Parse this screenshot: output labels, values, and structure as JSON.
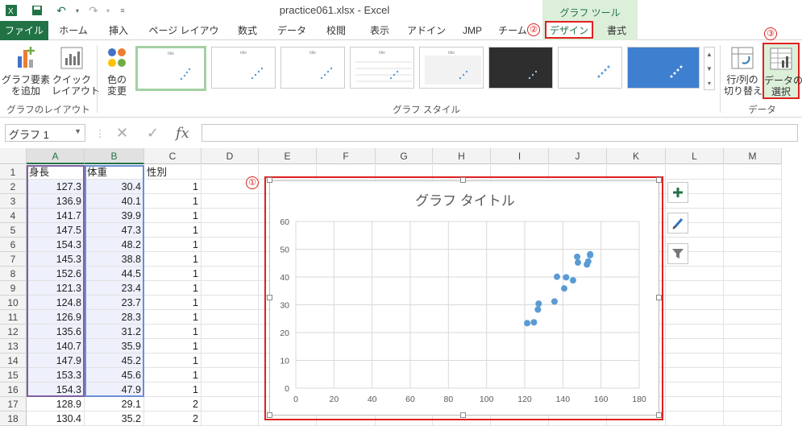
{
  "app": {
    "title": "practice061.xlsx - Excel",
    "context_tool": "グラフ ツール"
  },
  "tabs": [
    "ファイル",
    "ホーム",
    "挿入",
    "ページ レイアウト",
    "数式",
    "データ",
    "校閲",
    "表示",
    "アドイン",
    "JMP",
    "チーム",
    "デザイン",
    "書式"
  ],
  "ribbon": {
    "add_element": "グラフ要素\nを追加",
    "quick_layout": "クイック\nレイアウト",
    "change_colors": "色の\n変更",
    "layout_group": "グラフのレイアウト",
    "styles_group": "グラフ スタイル",
    "switch_rowcol": "行/列の\n切り替え",
    "select_data": "データの\n選択",
    "data_group": "データ"
  },
  "formula_bar": {
    "name_box": "グラフ 1",
    "formula": ""
  },
  "grid": {
    "columns": [
      "A",
      "B",
      "C",
      "D",
      "E",
      "F",
      "G",
      "H",
      "I",
      "J",
      "K",
      "L",
      "M"
    ],
    "rows": [
      [
        "身長",
        "体重",
        "性別"
      ],
      [
        "127.3",
        "30.4",
        "1"
      ],
      [
        "136.9",
        "40.1",
        "1"
      ],
      [
        "141.7",
        "39.9",
        "1"
      ],
      [
        "147.5",
        "47.3",
        "1"
      ],
      [
        "154.3",
        "48.2",
        "1"
      ],
      [
        "145.3",
        "38.8",
        "1"
      ],
      [
        "152.6",
        "44.5",
        "1"
      ],
      [
        "121.3",
        "23.4",
        "1"
      ],
      [
        "124.8",
        "23.7",
        "1"
      ],
      [
        "126.9",
        "28.3",
        "1"
      ],
      [
        "135.6",
        "31.2",
        "1"
      ],
      [
        "140.7",
        "35.9",
        "1"
      ],
      [
        "147.9",
        "45.2",
        "1"
      ],
      [
        "153.3",
        "45.6",
        "1"
      ],
      [
        "154.3",
        "47.9",
        "1"
      ],
      [
        "128.9",
        "29.1",
        "2"
      ],
      [
        "130.4",
        "35.2",
        "2"
      ]
    ]
  },
  "annotations": [
    "①",
    "②",
    "③"
  ],
  "chart_data": {
    "type": "scatter",
    "title": "グラフ タイトル",
    "xlim": [
      0,
      180
    ],
    "ylim": [
      0,
      60
    ],
    "xticks": [
      0,
      20,
      40,
      60,
      80,
      100,
      120,
      140,
      160,
      180
    ],
    "yticks": [
      0,
      10,
      20,
      30,
      40,
      50,
      60
    ],
    "grid": true,
    "series": [
      {
        "color": "#5b9bd5",
        "points": [
          [
            127.3,
            30.4
          ],
          [
            136.9,
            40.1
          ],
          [
            141.7,
            39.9
          ],
          [
            147.5,
            47.3
          ],
          [
            154.3,
            48.2
          ],
          [
            145.3,
            38.8
          ],
          [
            152.6,
            44.5
          ],
          [
            121.3,
            23.4
          ],
          [
            124.8,
            23.7
          ],
          [
            126.9,
            28.3
          ],
          [
            135.6,
            31.2
          ],
          [
            140.7,
            35.9
          ],
          [
            147.9,
            45.2
          ],
          [
            153.3,
            45.6
          ],
          [
            154.3,
            47.9
          ]
        ]
      }
    ]
  }
}
